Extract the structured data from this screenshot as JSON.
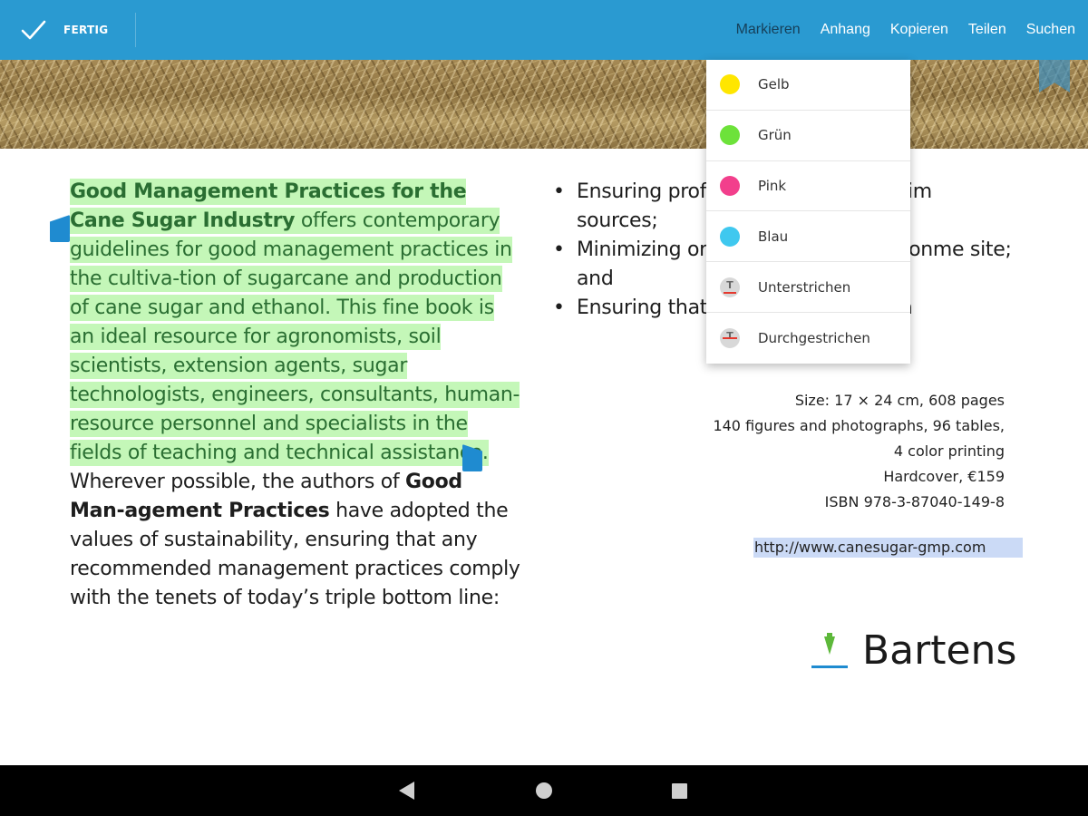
{
  "toolbar": {
    "done_label": "FERTIG",
    "actions": [
      "Markieren",
      "Anhang",
      "Kopieren",
      "Teilen",
      "Suchen"
    ],
    "active_action": "Markieren",
    "bar_color": "#2a9ad1"
  },
  "highlight_menu": {
    "items": [
      {
        "label": "Gelb",
        "color": "#ffe600",
        "icon": "color-swatch"
      },
      {
        "label": "Grün",
        "color": "#6de23a",
        "icon": "color-swatch"
      },
      {
        "label": "Pink",
        "color": "#f23f8c",
        "icon": "color-swatch"
      },
      {
        "label": "Blau",
        "color": "#3fc8ef",
        "icon": "color-swatch"
      },
      {
        "label": "Unterstrichen",
        "icon": "underline-icon"
      },
      {
        "label": "Durchgestrichen",
        "icon": "strikethrough-icon"
      }
    ]
  },
  "document": {
    "left": {
      "hl_bold": "Good Management Practices for the Cane Sugar Industry",
      "hl_text": " offers contemporary guidelines for good management practices in the cultiva-tion of sugarcane and production of cane sugar and ethanol. This fine book is an ideal resource for agronomists, soil scientists, extension agents, sugar technologists, engineers, consultants, human-resource personnel and specialists in the fields of teaching and technical assistance.",
      "p2_start": "Wherever possible, the authors of ",
      "p2_bold": "Good Man-agement Practices",
      "p2_end": " have adopted the values of sustainability, ensuring that any recommended management practices comply with the tenets of today’s triple bottom line:"
    },
    "bullets": [
      "Ensuring profi                         e main-taining and im                        sources;",
      "Minimizing or                          impacts to the environme                     site; and",
      "Ensuring that                          e in a socially equita"
    ],
    "details": [
      "Size: 17 × 24 cm, 608 pages",
      "140 figures and photographs, 96 tables,",
      "4 color printing",
      "Hardcover, €159",
      "ISBN 978-3-87040-149-8"
    ],
    "link": "http://www.canesugar-gmp.com",
    "brand": "Bartens"
  },
  "highlight_color": "#c4f7b8",
  "selection_color": "#cbdaf6"
}
